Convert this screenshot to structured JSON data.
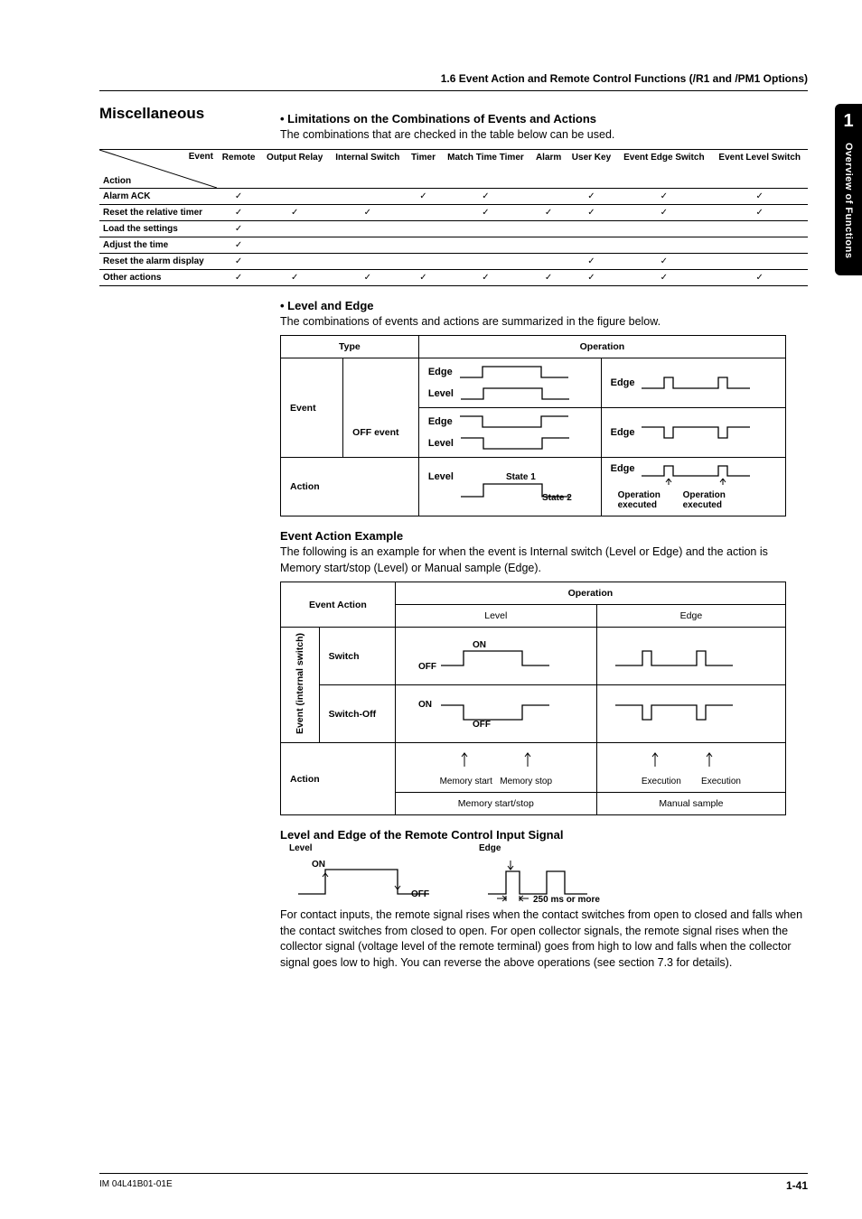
{
  "header": "1.6  Event Action and Remote Control Functions (/R1 and /PM1 Options)",
  "sidebar": {
    "num": "1",
    "label": "Overview of Functions"
  },
  "section_title": "Miscellaneous",
  "bullet1": "Limitations on the Combinations of Events and Actions",
  "bullet1_text": "The combinations that are checked in the table below can be used.",
  "combo_table": {
    "corner_event": "Event",
    "corner_action": "Action",
    "cols": [
      "Remote",
      "Output Relay",
      "Internal Switch",
      "Timer",
      "Match Time Timer",
      "Alarm",
      "User Key",
      "Event Edge Switch",
      "Event Level Switch"
    ],
    "rows": [
      {
        "label": "Alarm ACK",
        "c": [
          "✓",
          "",
          "",
          "✓",
          "✓",
          "",
          "✓",
          "✓",
          "✓"
        ]
      },
      {
        "label": "Reset the relative timer",
        "c": [
          "✓",
          "✓",
          "✓",
          "",
          "✓",
          "✓",
          "✓",
          "✓",
          "✓"
        ]
      },
      {
        "label": "Load the settings",
        "c": [
          "✓",
          "",
          "",
          "",
          "",
          "",
          "",
          "",
          ""
        ]
      },
      {
        "label": "Adjust the time",
        "c": [
          "✓",
          "",
          "",
          "",
          "",
          "",
          "",
          "",
          ""
        ]
      },
      {
        "label": "Reset the alarm display",
        "c": [
          "✓",
          "",
          "",
          "",
          "",
          "",
          "✓",
          "✓",
          ""
        ]
      },
      {
        "label": "Other actions",
        "c": [
          "✓",
          "✓",
          "✓",
          "✓",
          "✓",
          "✓",
          "✓",
          "✓",
          "✓"
        ]
      }
    ]
  },
  "bullet2": "Level and Edge",
  "bullet2_text": "The combinations of events and actions are summarized in the figure below.",
  "level_edge_table": {
    "type_head": "Type",
    "op_head": "Operation",
    "event_label": "Event",
    "off_event_label": "OFF event",
    "action_label": "Action",
    "edge": "Edge",
    "level": "Level",
    "state1": "State 1",
    "state2": "State 2",
    "op_exec": "Operation executed"
  },
  "example_head": "Event Action Example",
  "example_text": "The following is an example for when the event is Internal switch (Level or Edge) and the action is Memory start/stop (Level) or Manual sample (Edge).",
  "example_table": {
    "ea_head": "Event Action",
    "op_head": "Operation",
    "level": "Level",
    "edge": "Edge",
    "event_group": "Event (internal switch)",
    "switch": "Switch",
    "switch_off": "Switch-Off",
    "action": "Action",
    "on": "ON",
    "off": "OFF",
    "mem_start": "Memory start",
    "mem_stop": "Memory stop",
    "mem_ss": "Memory start/stop",
    "exec": "Execution",
    "manual": "Manual sample"
  },
  "remote_head": "Level and Edge of the Remote Control Input Signal",
  "remote": {
    "level": "Level",
    "edge": "Edge",
    "on": "ON",
    "off": "OFF",
    "ms": "250 ms or more"
  },
  "remote_text": "For contact inputs, the remote signal rises when the contact switches from open to closed and falls when the contact switches from closed to open. For open collector signals, the remote signal rises when the collector signal (voltage level of the remote terminal) goes from high to low and falls when the collector signal goes low to high. You can reverse the above operations (see section 7.3 for details).",
  "footer": {
    "doc": "IM 04L41B01-01E",
    "page": "1-41"
  }
}
